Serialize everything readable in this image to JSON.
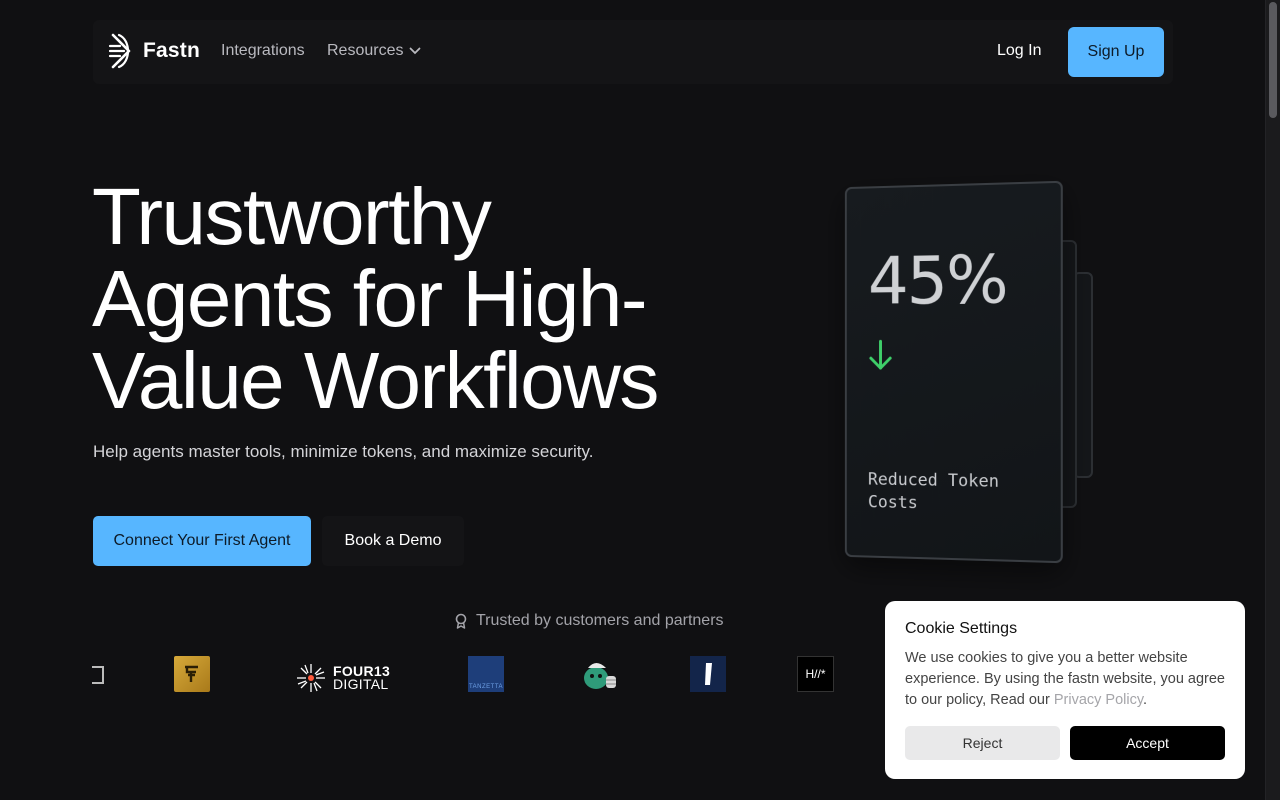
{
  "nav": {
    "brand": "Fastn",
    "links": [
      "Integrations",
      "Resources"
    ],
    "login_label": "Log In",
    "signup_label": "Sign Up"
  },
  "hero": {
    "title_lines": [
      "Trustworthy",
      "Agents for High-",
      "Value Workflows"
    ],
    "subtitle": "Help agents master tools, minimize tokens, and maximize security.",
    "primary_cta": "Connect Your First Agent",
    "secondary_cta": "Book a Demo"
  },
  "stat_card": {
    "value": "45%",
    "label": "Reduced Token Costs",
    "arrow_color": "#3fcf6a"
  },
  "trusted": {
    "label": "Trusted by customers and partners",
    "logos": [
      {
        "icon": "partial-logo"
      },
      {
        "icon": "gold-p-logo"
      },
      {
        "icon": "four13-digital-logo",
        "text_top": "FOUR13",
        "text_bottom": "DIGITAL"
      },
      {
        "icon": "zetta-logo",
        "text": "TANZETTA"
      },
      {
        "icon": "creature-logo"
      },
      {
        "icon": "one-logo"
      },
      {
        "icon": "hw-logo",
        "text": "H//*"
      }
    ]
  },
  "cookie": {
    "title": "Cookie Settings",
    "body": "We use cookies to give you a better website experience. By using the fastn website, you agree to our policy, Read our ",
    "link": "Privacy Policy",
    "tail": ".",
    "reject_label": "Reject",
    "accept_label": "Accept"
  },
  "colors": {
    "background": "#101012",
    "accent": "#57b6ff"
  }
}
